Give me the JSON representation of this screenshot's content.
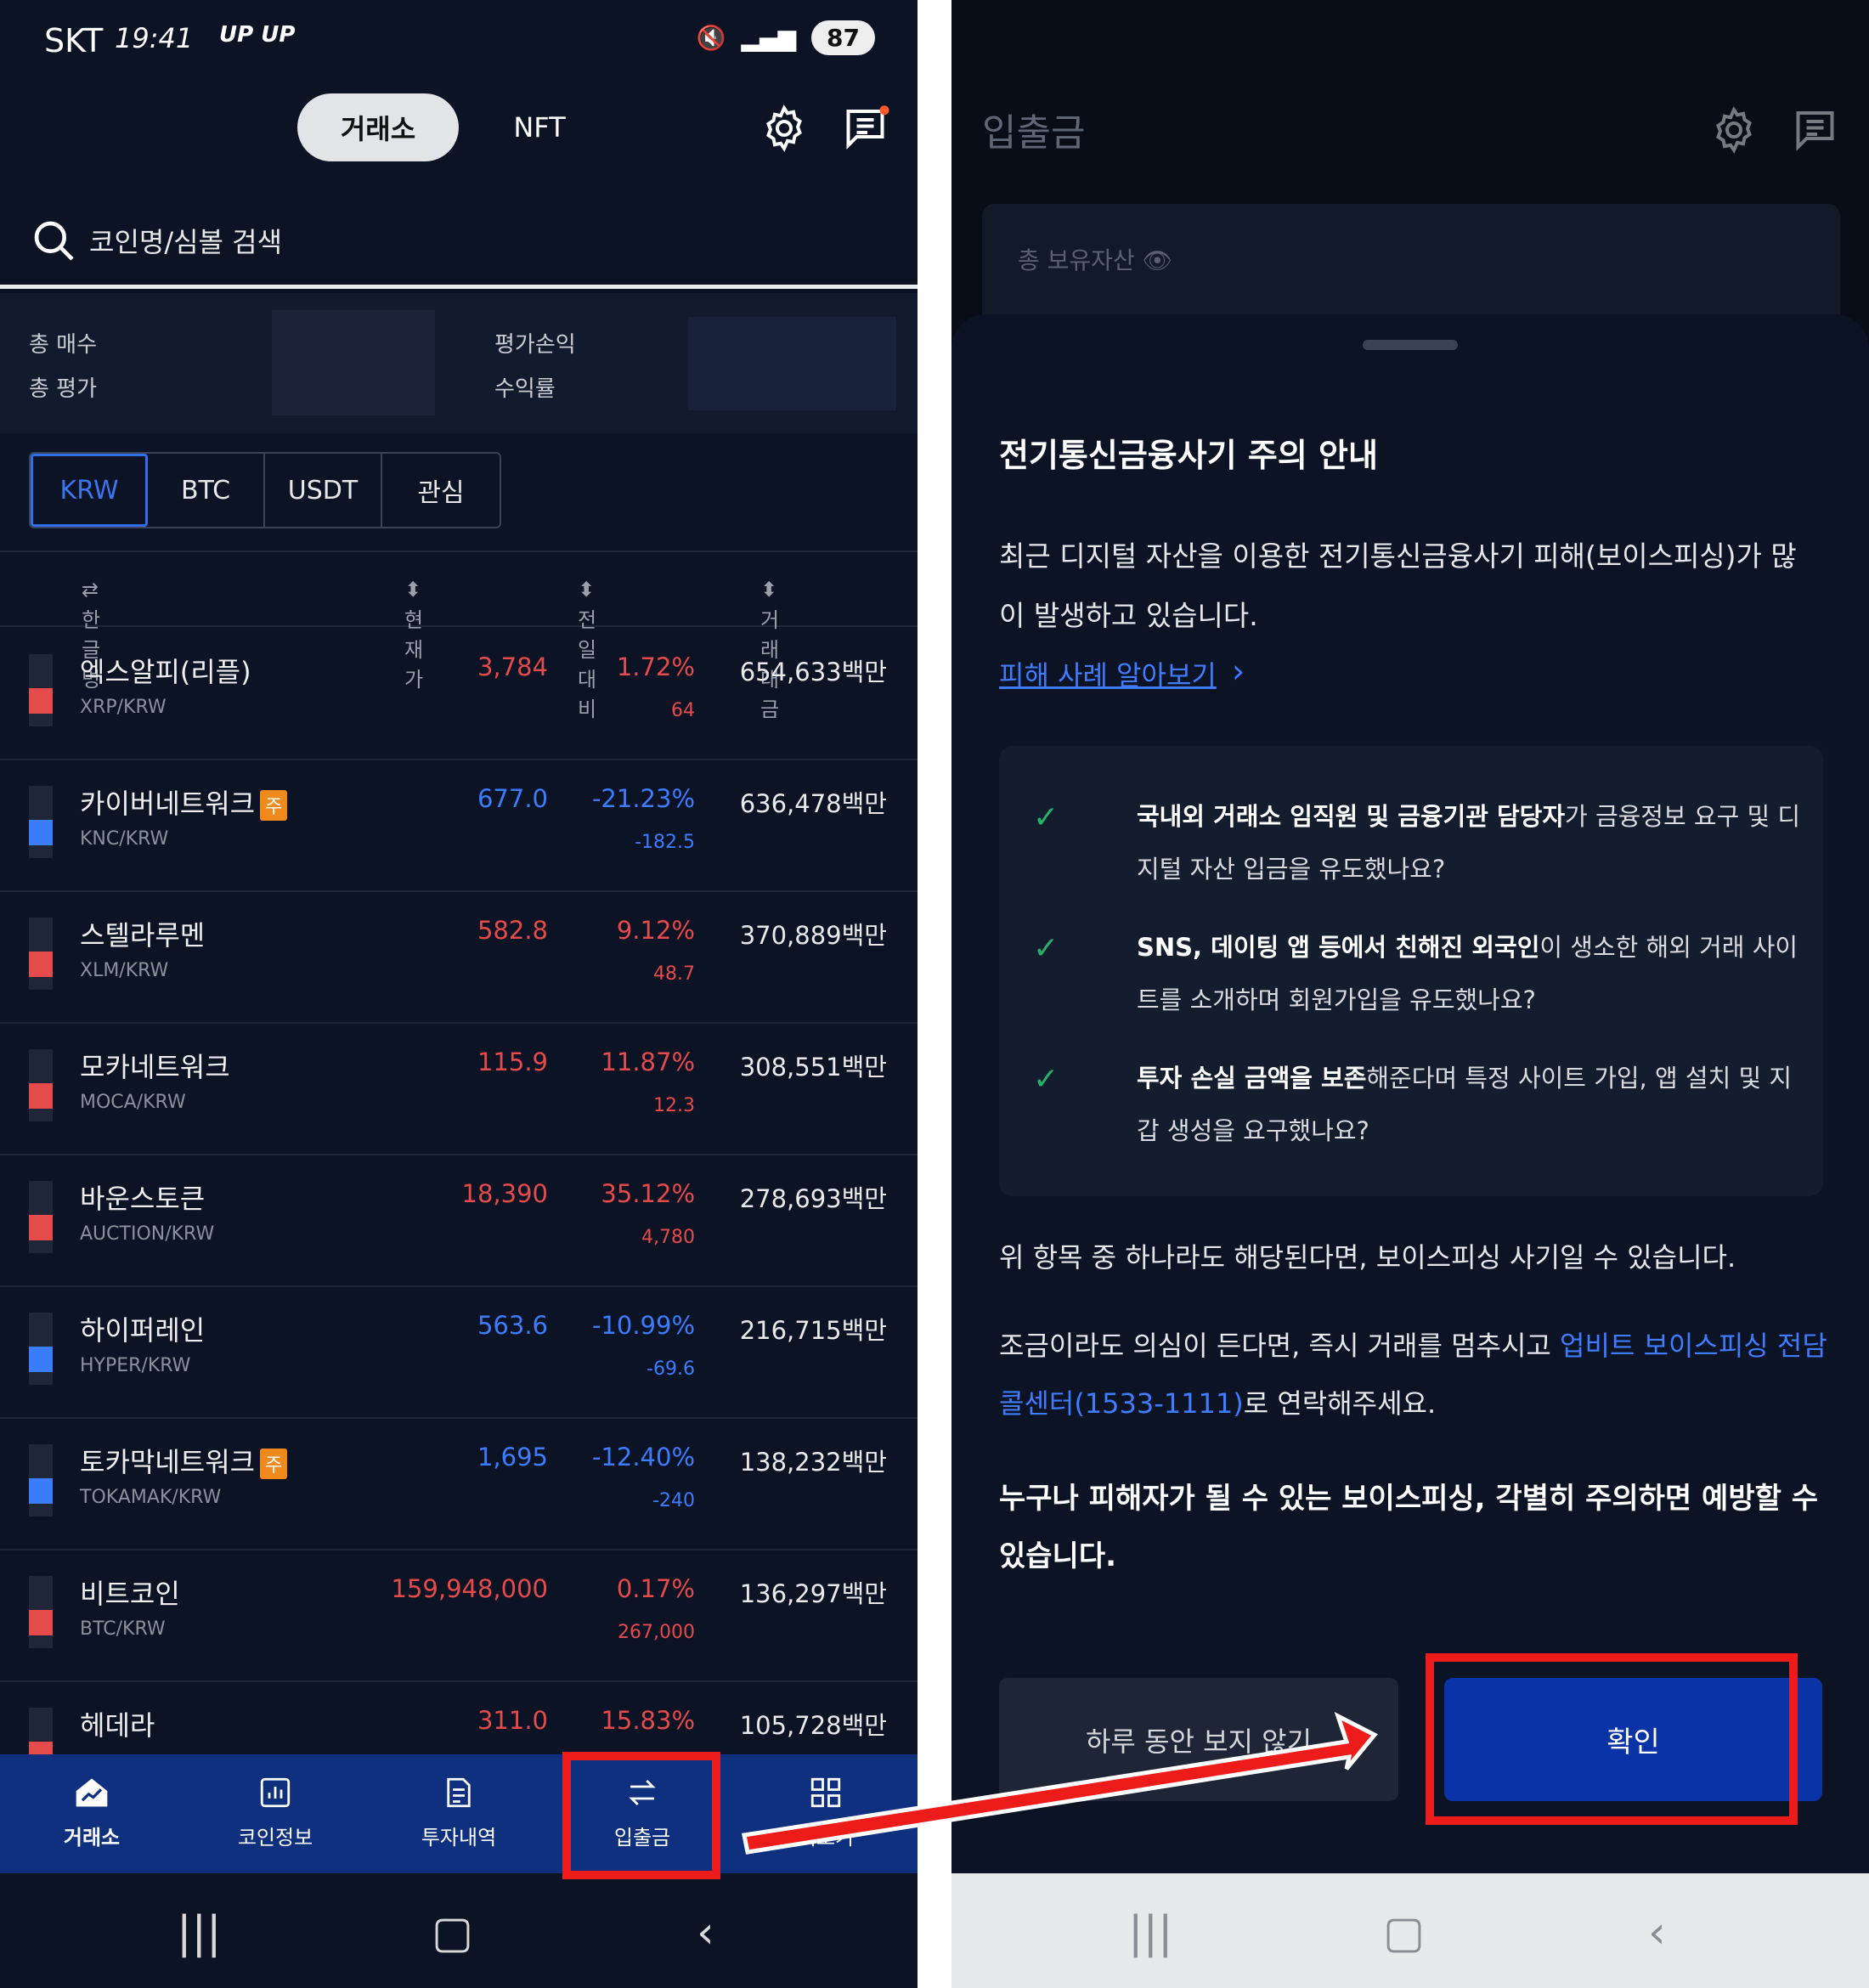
{
  "left": {
    "status": {
      "carrier": "SKT",
      "time": "19:41",
      "extra": "UP UP",
      "battery": "87"
    },
    "tabs": {
      "exchange": "거래소",
      "nft": "NFT"
    },
    "search": {
      "placeholder": "코인명/심볼 검색"
    },
    "summary": {
      "buy": "총 매수",
      "eval": "총 평가",
      "pnl": "평가손익",
      "ret": "수익률"
    },
    "currency_tabs": [
      "KRW",
      "BTC",
      "USDT",
      "관심"
    ],
    "columns": {
      "name": "한글명",
      "price": "현재가",
      "change": "전일대비",
      "volume": "거래대금"
    },
    "rows": [
      {
        "name": "엑스알피(리플)",
        "badge": "",
        "symbol": "XRP/KRW",
        "price": "3,784",
        "change": "1.72%",
        "change_value": "64",
        "volume": "654,633백만",
        "dir": "up"
      },
      {
        "name": "카이버네트워크",
        "badge": "주",
        "symbol": "KNC/KRW",
        "price": "677.0",
        "change": "-21.23%",
        "change_value": "-182.5",
        "volume": "636,478백만",
        "dir": "down"
      },
      {
        "name": "스텔라루멘",
        "badge": "",
        "symbol": "XLM/KRW",
        "price": "582.8",
        "change": "9.12%",
        "change_value": "48.7",
        "volume": "370,889백만",
        "dir": "up"
      },
      {
        "name": "모카네트워크",
        "badge": "",
        "symbol": "MOCA/KRW",
        "price": "115.9",
        "change": "11.87%",
        "change_value": "12.3",
        "volume": "308,551백만",
        "dir": "up"
      },
      {
        "name": "바운스토큰",
        "badge": "",
        "symbol": "AUCTION/KRW",
        "price": "18,390",
        "change": "35.12%",
        "change_value": "4,780",
        "volume": "278,693백만",
        "dir": "up"
      },
      {
        "name": "하이퍼레인",
        "badge": "",
        "symbol": "HYPER/KRW",
        "price": "563.6",
        "change": "-10.99%",
        "change_value": "-69.6",
        "volume": "216,715백만",
        "dir": "down"
      },
      {
        "name": "토카막네트워크",
        "badge": "주",
        "symbol": "TOKAMAK/KRW",
        "price": "1,695",
        "change": "-12.40%",
        "change_value": "-240",
        "volume": "138,232백만",
        "dir": "down"
      },
      {
        "name": "비트코인",
        "badge": "",
        "symbol": "BTC/KRW",
        "price": "159,948,000",
        "change": "0.17%",
        "change_value": "267,000",
        "volume": "136,297백만",
        "dir": "up"
      },
      {
        "name": "헤데라",
        "badge": "",
        "symbol": "",
        "price": "311.0",
        "change": "15.83%",
        "change_value": "",
        "volume": "105,728백만",
        "dir": "up"
      }
    ],
    "bottom_nav": [
      "거래소",
      "코인정보",
      "투자내역",
      "입출금",
      "더보기"
    ]
  },
  "right": {
    "title": "입출금",
    "card_label": "총 보유자산",
    "sheet": {
      "title": "전기통신금융사기 주의 안내",
      "body": "최근 디지털 자산을 이용한 전기통신금융사기 피해(보이스피싱)가 많이 발생하고 있습니다.",
      "link": "피해 사례 알아보기",
      "checks": [
        {
          "bold": "국내외 거래소 임직원 및 금융기관 담당자",
          "rest": "가 금융정보 요구 및 디지털 자산 입금을 유도했나요?"
        },
        {
          "bold": "SNS, 데이팅 앱 등에서 친해진 외국인",
          "rest": "이 생소한 해외 거래 사이트를 소개하며 회원가입을 유도했나요?"
        },
        {
          "bold": "투자 손실 금액을 보존",
          "rest": "해준다며 특정 사이트 가입, 앱 설치 및 지갑 생성을 요구했나요?"
        }
      ],
      "warn1": "위 항목 중 하나라도 해당된다면, 보이스피싱 사기일 수 있습니다.",
      "warn2_pre": "조금이라도 의심이 든다면, 즉시 거래를 멈추시고 ",
      "warn2_hl": "업비트 보이스피싱 전담 콜센터(1533-1111)",
      "warn2_post": "로 연락해주세요.",
      "warn3": "누구나 피해자가 될 수 있는 보이스피싱, 각별히 주의하면 예방할 수 있습니다.",
      "btn_later": "하루 동안 보지 않기",
      "btn_ok": "확인"
    }
  },
  "colors": {
    "up": "#e64b4b",
    "down": "#3c7cff",
    "accent": "#0a33a8",
    "annotation": "#ee1b1b"
  }
}
